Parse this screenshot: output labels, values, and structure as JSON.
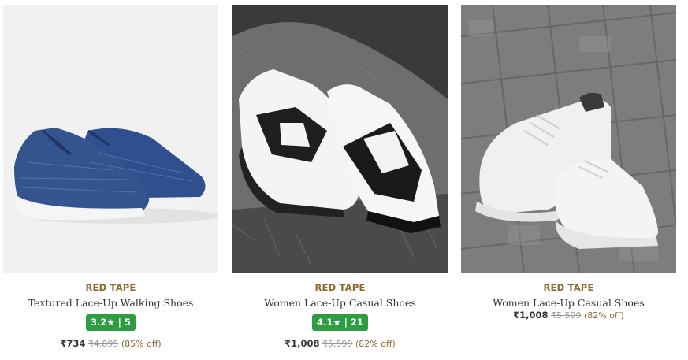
{
  "products": [
    {
      "brand": "RED TAPE",
      "name": "Textured Lace-Up Walking Shoes",
      "rating": "3.2★ | 5",
      "price": "₹734",
      "mrp": "₹4,895",
      "discount": "(85% off)",
      "image": "blue-knit-running-shoes"
    },
    {
      "brand": "RED TAPE",
      "name": "Women Lace-Up Casual Shoes",
      "rating": "4.1★ | 21",
      "price": "₹1,008",
      "mrp": "₹5,599",
      "discount": "(82% off)",
      "image": "black-white-sneakers-on-rock"
    },
    {
      "brand": "RED TAPE",
      "name": "Women Lace-Up Casual Shoes",
      "rating": "",
      "price": "₹1,008",
      "mrp": "₹5,599",
      "discount": "(82% off)",
      "image": "white-sneakers-on-tiles"
    }
  ],
  "colors": {
    "brand": "#8a6a2f",
    "rating_bg": "#2e9d42"
  }
}
